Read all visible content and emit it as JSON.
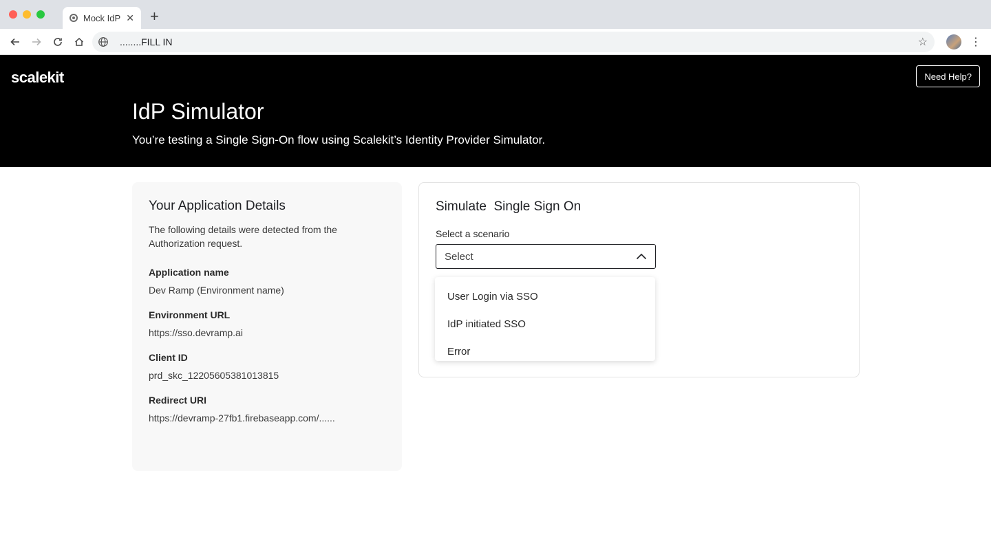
{
  "browser": {
    "tab_title": "Mock IdP",
    "url": "........FILL IN"
  },
  "header": {
    "logo": "scalekit",
    "help_button": "Need Help?",
    "title": "IdP Simulator",
    "subtitle": "You’re testing a Single Sign-On flow using Scalekit’s Identity Provider Simulator."
  },
  "details": {
    "title": "Your Application Details",
    "description": "The following details were detected from the Authorization request.",
    "fields": [
      {
        "label": "Application name",
        "value": "Dev Ramp (Environment name)"
      },
      {
        "label": "Environment URL",
        "value": "https://sso.devramp.ai"
      },
      {
        "label": "Client ID",
        "value": "prd_skc_12205605381013815"
      },
      {
        "label": "Redirect URI",
        "value": "https://devramp-27fb1.firebaseapp.com/......"
      }
    ]
  },
  "simulate": {
    "title": "Simulate  Single Sign On",
    "select_label": "Select a scenario",
    "select_placeholder": "Select",
    "options": [
      "User Login via SSO",
      "IdP initiated SSO",
      "Error"
    ]
  }
}
